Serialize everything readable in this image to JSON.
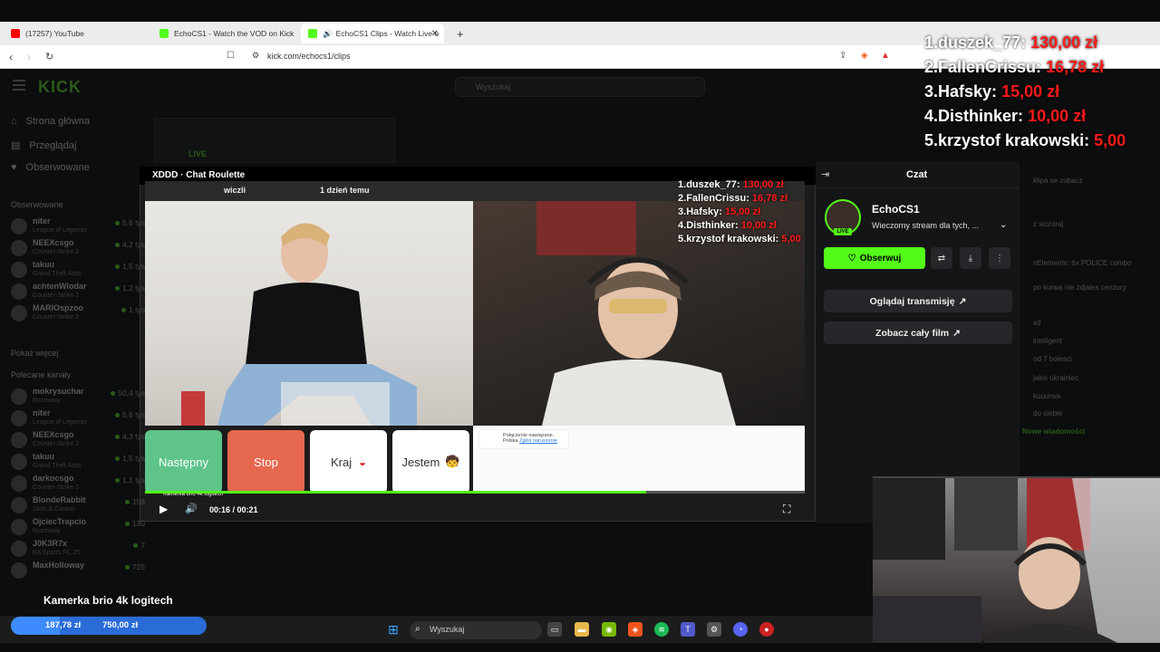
{
  "browser": {
    "tabs": [
      {
        "label": "(17257) YouTube",
        "color": "#ff0000"
      },
      {
        "label": "EchoCS1 - Watch the VOD on Kick",
        "color": "#53fc18"
      },
      {
        "label": "EchoCS1 Clips - Watch Live o",
        "color": "#53fc18"
      }
    ],
    "url": "kick.com/echocs1/clips",
    "new_tab": "+"
  },
  "kick": {
    "logo": "KICK",
    "search_placeholder": "Wyszukaj",
    "nav": [
      {
        "label": "Strona główna",
        "icon": "home-icon"
      },
      {
        "label": "Przeglądaj",
        "icon": "browse-icon"
      },
      {
        "label": "Obserwowane",
        "icon": "heart-icon"
      }
    ],
    "followed_title": "Obserwowane",
    "followed": [
      {
        "name": "niter",
        "game": "League of Legends",
        "viewers": "5,6 tys"
      },
      {
        "name": "NEEXcsgo",
        "game": "Counter-Strike 2",
        "viewers": "4,2 tys"
      },
      {
        "name": "takuu",
        "game": "Grand Theft Auto",
        "viewers": "1,5 tys"
      },
      {
        "name": "achtenWlodar",
        "game": "Counter-Strike 2",
        "viewers": "1,2 tys"
      },
      {
        "name": "MARIOspzoo",
        "game": "Counter-Strike 2",
        "viewers": "1 tys"
      }
    ],
    "show_more": "Pokaż więcej",
    "recommended_title": "Polecane kanały",
    "recommended": [
      {
        "name": "mokrysuchar",
        "game": "Rozmowy",
        "viewers": "50,4 tys"
      },
      {
        "name": "niter",
        "game": "League of Legends",
        "viewers": "5,6 tys"
      },
      {
        "name": "NEEXcsgo",
        "game": "Counter-Strike 2",
        "viewers": "4,3 tys"
      },
      {
        "name": "takuu",
        "game": "Grand Theft Auto",
        "viewers": "1,5 tys"
      },
      {
        "name": "darkocsgo",
        "game": "Counter-Strike 2",
        "viewers": "1,1 tys"
      },
      {
        "name": "BlondeRabbit",
        "game": "Slots & Casino",
        "viewers": "158"
      },
      {
        "name": "OjciecTrapcio",
        "game": "Rozmowy",
        "viewers": "130"
      },
      {
        "name": "J0K3R7x",
        "game": "EA Sports FC 25",
        "viewers": "7"
      },
      {
        "name": "MaxHolloway",
        "game": "",
        "viewers": "725"
      }
    ],
    "live_label": "LIVE"
  },
  "clip": {
    "author": "XDDD",
    "title": "Chat Roulette",
    "clipper": "wiczli",
    "age": "1 dzień temu",
    "buttons": {
      "next": "Następny",
      "stop": "Stop",
      "country": "Kraj",
      "iam": "Jestem"
    },
    "chat_msg": "Połączenie nawiązane.",
    "chat_country": "Polska",
    "chat_link": "Zgłoś naruszenie",
    "tooltip": "Kamerka brio 4k logitech",
    "time": "00:16 / 00:21",
    "progress": 0.76
  },
  "chat_panel": {
    "title": "Czat",
    "channel": "EchoCS1",
    "description": "Wieczorny stream dla tych, ...",
    "live": "LIVE",
    "follow": "Obserwuj",
    "watch_stream": "Oglądaj transmisję",
    "full_video": "Zobacz cały film"
  },
  "bg_chat": [
    "klipa se zobacz",
    "z wczoraj",
    "nElements: 6x POLICE combo",
    "po kurwa nie zdjales cenzury",
    "xd",
    "inteligent",
    "od 7 bolesci",
    "jakis ukrainiec",
    "kuuurwa",
    "do siebie",
    "Nowe wiadomości"
  ],
  "donations": [
    {
      "rank": "1.",
      "name": "duszek_77:",
      "amount": "130,00 zł"
    },
    {
      "rank": "2.",
      "name": "FallenCrissu:",
      "amount": "16,78 zł"
    },
    {
      "rank": "3.",
      "name": "Hafsky:",
      "amount": "15,00 zł"
    },
    {
      "rank": "4.",
      "name": "Disthinker:",
      "amount": "10,00 zł"
    },
    {
      "rank": "5.",
      "name": "krzystof krakowski:",
      "amount": "5,00"
    }
  ],
  "overlay": {
    "cam_caption": "Kamerka brio 4k logitech",
    "goal_current": "187,78 zł",
    "goal_target": "750,00 zł",
    "goal_progress": 0.25
  },
  "taskbar": {
    "search": "Wyszukaj"
  },
  "colors": {
    "kick_green": "#53fc18",
    "donation_red": "#ff1a1a",
    "next_btn": "#5ec48a",
    "stop_btn": "#e5684f"
  }
}
